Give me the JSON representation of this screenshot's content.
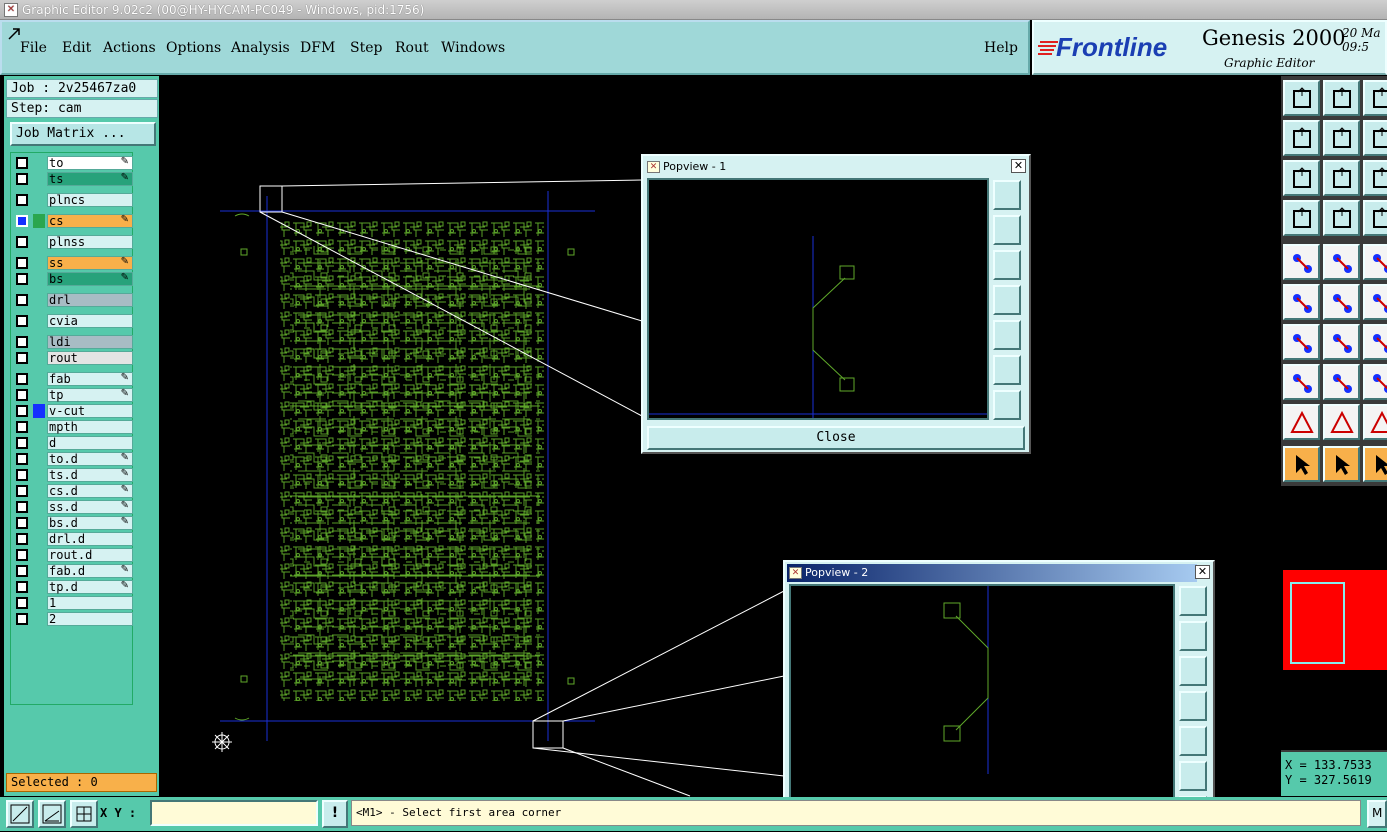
{
  "window": {
    "title": "Graphic Editor 9.02c2 (00@HY-HYCAM-PC049 - Windows, pid:1756)"
  },
  "menu": {
    "items": [
      "File",
      "Edit",
      "Actions",
      "Options",
      "Analysis",
      "DFM",
      "Step",
      "Rout",
      "Windows"
    ],
    "help": "Help"
  },
  "brand": {
    "company": "Frontline",
    "product": "Genesis 2000",
    "subtitle": "Graphic Editor",
    "datetime": "20 Ma\n09:5"
  },
  "job": {
    "job_label": "Job : 2v25467za0",
    "step_label": "Step: cam",
    "matrix_button": "Job Matrix ..."
  },
  "layers": [
    {
      "name": "to",
      "color": "#ffffff",
      "edit": true
    },
    {
      "name": "ts",
      "color": "#27a27b",
      "edit": true
    },
    {
      "name": "plncs",
      "color": "#d6f2f2",
      "edit": false
    },
    {
      "name": "cs",
      "color": "#f8b04a",
      "edit": true,
      "active": true
    },
    {
      "name": "plnss",
      "color": "#d6f2f2",
      "edit": false
    },
    {
      "name": "ss",
      "color": "#f8b04a",
      "edit": true
    },
    {
      "name": "bs",
      "color": "#27a27b",
      "edit": true
    },
    {
      "name": "drl",
      "color": "#a8bcc4",
      "edit": false
    },
    {
      "name": "cvia",
      "color": "#d6f2f2",
      "edit": false
    },
    {
      "name": "ldi",
      "color": "#a8bcc4",
      "edit": false
    },
    {
      "name": "rout",
      "color": "#e4e4e4",
      "edit": false
    },
    {
      "name": "fab",
      "color": "#d6f2f2",
      "edit": true
    },
    {
      "name": "tp",
      "color": "#d6f2f2",
      "edit": true
    },
    {
      "name": "v-cut",
      "color": "#d6f2f2",
      "edit": false,
      "swatch": "#1530ff"
    },
    {
      "name": "mpth",
      "color": "#d6f2f2",
      "edit": false
    },
    {
      "name": "d",
      "color": "#d6f2f2",
      "edit": false
    },
    {
      "name": "to.d",
      "color": "#d6f2f2",
      "edit": true
    },
    {
      "name": "ts.d",
      "color": "#d6f2f2",
      "edit": true
    },
    {
      "name": "cs.d",
      "color": "#d6f2f2",
      "edit": true
    },
    {
      "name": "ss.d",
      "color": "#d6f2f2",
      "edit": true
    },
    {
      "name": "bs.d",
      "color": "#d6f2f2",
      "edit": true
    },
    {
      "name": "drl.d",
      "color": "#d6f2f2",
      "edit": false
    },
    {
      "name": "rout.d",
      "color": "#d6f2f2",
      "edit": false
    },
    {
      "name": "fab.d",
      "color": "#d6f2f2",
      "edit": true
    },
    {
      "name": "tp.d",
      "color": "#d6f2f2",
      "edit": true
    },
    {
      "name": "1",
      "color": "#d6f2f2",
      "edit": false
    },
    {
      "name": "2",
      "color": "#d6f2f2",
      "edit": false
    }
  ],
  "selected": "Selected : 0",
  "bottom": {
    "xy_label": "X Y :",
    "xy_value": "",
    "excl": "!",
    "message": "<M1> - Select first area corner",
    "right_btn": "M"
  },
  "coords": {
    "x": "X = 133.7533",
    "y": "Y = 327.5619"
  },
  "popview1": {
    "title": "Popview - 1",
    "close": "Close"
  },
  "popview2": {
    "title": "Popview - 2"
  },
  "colors": {
    "trace": "#5fa82a",
    "outline": "#1a2fd6",
    "panel": "#56c9ab",
    "menubar": "#9fd8d8",
    "active": "#ff0000"
  }
}
